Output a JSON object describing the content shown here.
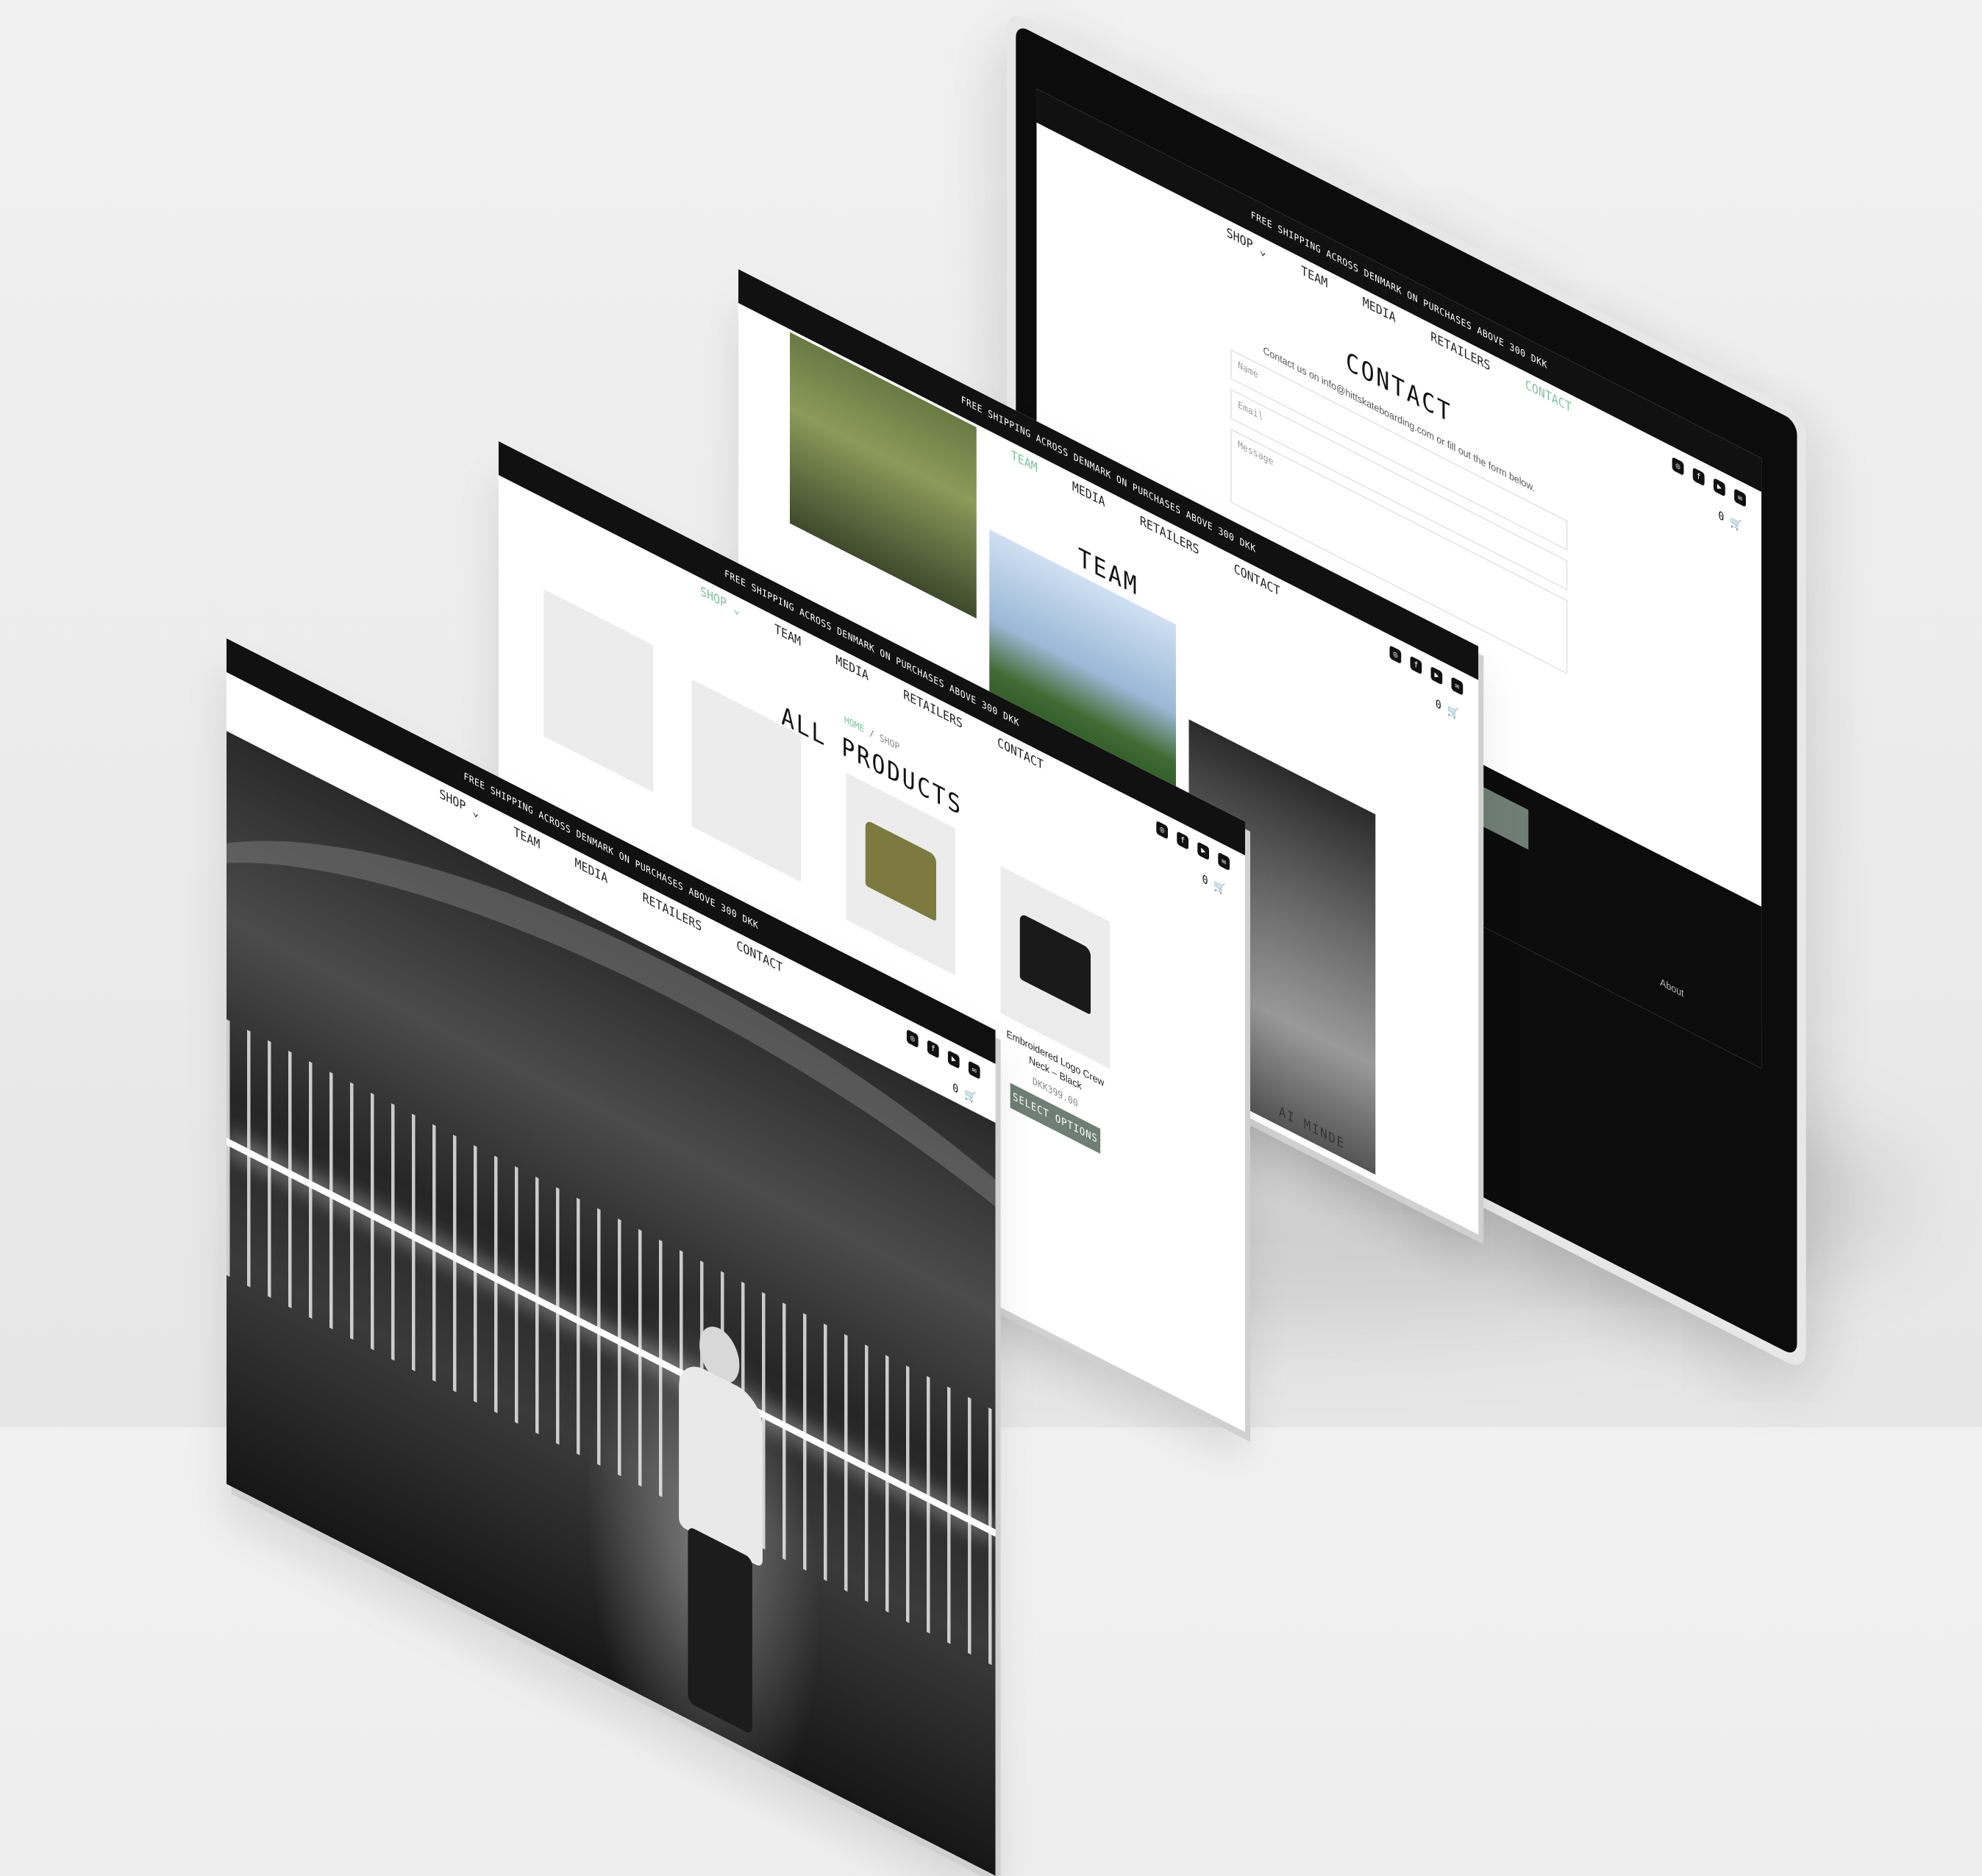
{
  "shared": {
    "shipping_banner": "FREE SHIPPING ACROSS DENMARK ON PURCHASES ABOVE 300 DKK",
    "nav": {
      "shop": "SHOP ⌄",
      "team": "TEAM",
      "media": "MEDIA",
      "retailers": "RETAILERS",
      "contact": "CONTACT"
    },
    "social_icons": [
      "instagram-icon",
      "facebook-icon",
      "youtube-icon",
      "mail-icon"
    ],
    "cart_count": "0",
    "accent_color": "#7fbf9f",
    "button_color": "#6f7f76"
  },
  "contact_page": {
    "title": "CONTACT",
    "intro": "Contact us on info@hittskateboarding.com or fill out the form below.",
    "name_placeholder": "Name",
    "email_placeholder": "Email",
    "message_placeholder": "Message",
    "footer_link": "About"
  },
  "team_page": {
    "title": "TEAM",
    "caption_partial": "AI MINDE"
  },
  "shop_page": {
    "breadcrumb_home": "HOME",
    "breadcrumb_sep": "/",
    "breadcrumb_current": "SHOP",
    "title": "ALL PRODUCTS",
    "featured_product": {
      "name": "Embroidered Logo Crew Neck – Black",
      "price": "DKK399.00",
      "button": "SELECT OPTIONS"
    }
  },
  "home_page": {}
}
